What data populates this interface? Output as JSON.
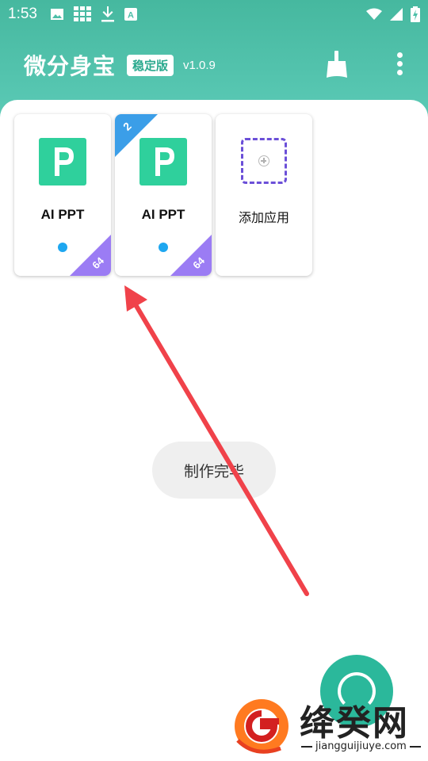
{
  "status_bar": {
    "time": "1:53",
    "icons": [
      "image-icon",
      "grid-icon",
      "download-icon",
      "a-icon"
    ],
    "right_icons": [
      "wifi-icon",
      "signal-icon",
      "battery-charging-icon"
    ]
  },
  "appbar": {
    "title": "微分身宝",
    "badge": "稳定版",
    "version": "v1.0.9",
    "actions": [
      "broom-icon",
      "more-vert-icon"
    ]
  },
  "apps": [
    {
      "name": "AI PPT",
      "icon": "P",
      "arch": "64",
      "clone_index": "",
      "running_dot": true
    },
    {
      "name": "AI PPT",
      "icon": "P",
      "arch": "64",
      "clone_index": "2",
      "running_dot": true
    }
  ],
  "add_app": {
    "label": "添加应用",
    "icon": "add-dashed-icon"
  },
  "toast": {
    "text": "制作完毕"
  },
  "watermark": {
    "text": "绛癸网",
    "sub": "jiangguijiuye.com"
  },
  "colors": {
    "brand": "#4cbfa8",
    "app_icon_bg": "#2fd09c",
    "arch_badge": "#9b7cf4",
    "clone_badge": "#3b9ee8",
    "running_dot": "#1ea7f0",
    "arrow": "#f0424a"
  }
}
